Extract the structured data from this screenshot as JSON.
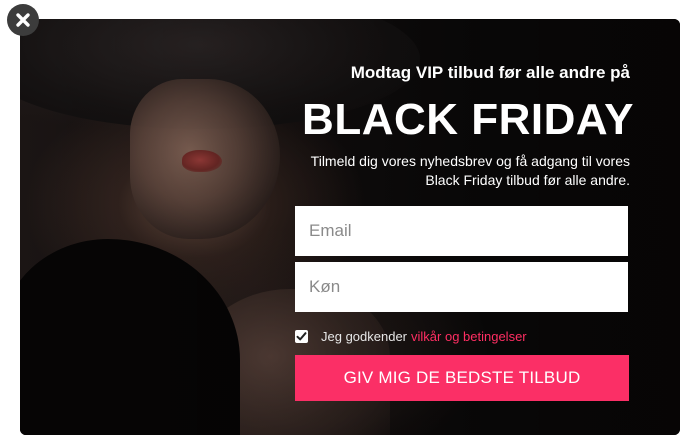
{
  "popup": {
    "close_icon": "close-icon",
    "tagline": "Modtag VIP tilbud før alle andre på",
    "headline": "BLACK FRIDAY",
    "description": "Tilmeld dig vores nyhedsbrev og få adgang til vores Black Friday tilbud før alle andre.",
    "form": {
      "email": {
        "value": "",
        "placeholder": "Email"
      },
      "gender": {
        "value": "",
        "placeholder": "Køn"
      },
      "consent": {
        "checked": true,
        "label": "Jeg godkender",
        "link_text": "vilkår og betingelser"
      },
      "submit_label": "GIV MIG DE BEDSTE TILBUD"
    }
  },
  "colors": {
    "accent": "#fb2f66",
    "link": "#ff2e63",
    "overlay": "#0c0a0a",
    "close_button": "#3c3c3c"
  }
}
